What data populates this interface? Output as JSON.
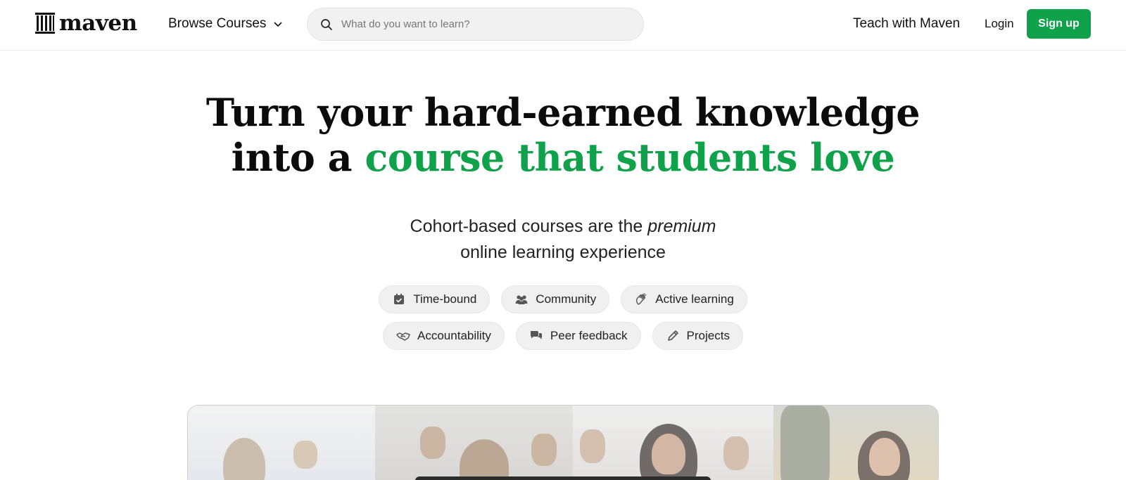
{
  "brand": {
    "name": "maven",
    "accent_color": "#10a24a"
  },
  "nav": {
    "browse_label": "Browse Courses",
    "search_placeholder": "What do you want to learn?",
    "teach_label": "Teach with Maven",
    "login_label": "Login",
    "signup_label": "Sign up"
  },
  "hero": {
    "title_line1": "Turn your hard-earned knowledge",
    "title_line2_prefix": "into a ",
    "title_line2_accent": "course that students love",
    "subtitle_part1": "Cohort-based courses are the ",
    "subtitle_emphasis": "premium",
    "subtitle_line2": "online learning experience"
  },
  "features": [
    {
      "label": "Time-bound",
      "icon": "calendar-check-icon"
    },
    {
      "label": "Community",
      "icon": "people-icon"
    },
    {
      "label": "Active learning",
      "icon": "clapping-hands-icon"
    },
    {
      "label": "Accountability",
      "icon": "handshake-icon"
    },
    {
      "label": "Peer feedback",
      "icon": "chat-bubbles-icon"
    },
    {
      "label": "Projects",
      "icon": "pencil-icon"
    }
  ]
}
